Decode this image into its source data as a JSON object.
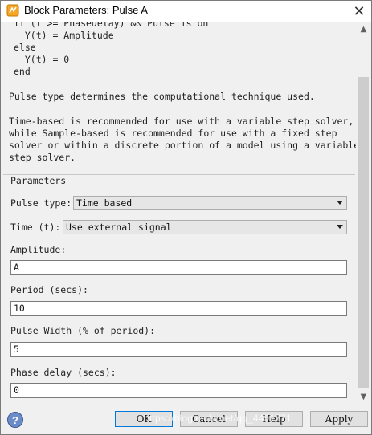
{
  "window": {
    "title": "Block Parameters: Pulse A",
    "close_icon": "close-icon"
  },
  "description": {
    "code_lines": "if (t >= PhaseDelay) && Pulse is on\n  Y(t) = Amplitude\nelse\n  Y(t) = 0\nend",
    "para1": "Pulse type determines the computational technique used.",
    "para2": "Time-based is recommended for use with a variable step solver,\nwhile Sample-based is recommended for use with a fixed step\nsolver or within a discrete portion of a model using a variable\nstep solver."
  },
  "parameters": {
    "group_label": "Parameters",
    "pulse_type": {
      "label": "Pulse type:",
      "value": "Time based"
    },
    "time": {
      "label": "Time (t):",
      "value": "Use external signal"
    },
    "amplitude": {
      "label": "Amplitude:",
      "value": "A"
    },
    "period": {
      "label": "Period (secs):",
      "value": "10"
    },
    "pulse_width": {
      "label": "Pulse Width (% of period):",
      "value": "5"
    },
    "phase_delay": {
      "label": "Phase delay (secs):",
      "value": "0"
    }
  },
  "buttons": {
    "help_label": "?",
    "ok": "OK",
    "cancel": "Cancel",
    "help": "Help",
    "apply": "Apply"
  },
  "watermark": "https://blog.csdn.net/qq_4491771"
}
